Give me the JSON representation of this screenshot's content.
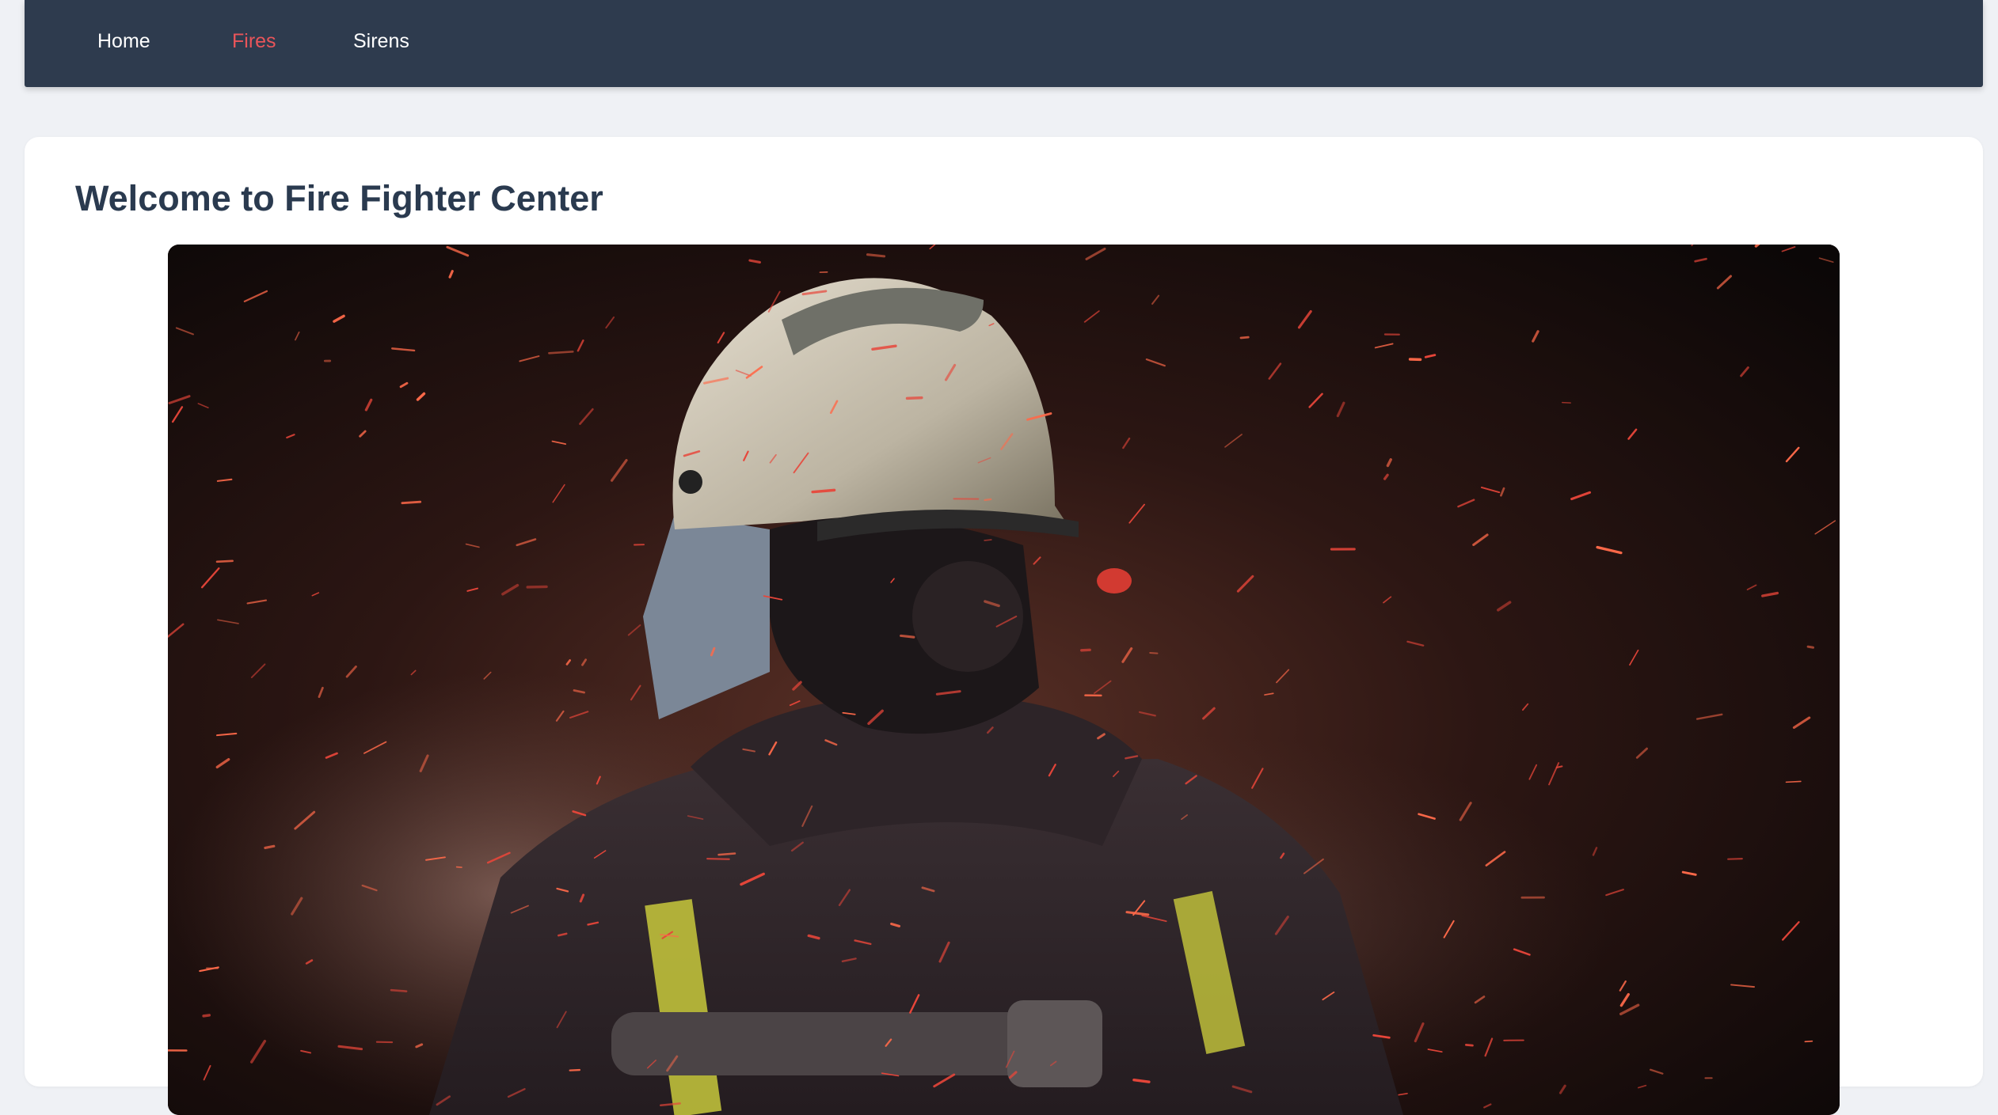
{
  "nav": {
    "items": [
      {
        "label": "Home",
        "active": false
      },
      {
        "label": "Fires",
        "active": true
      },
      {
        "label": "Sirens",
        "active": false
      }
    ]
  },
  "main": {
    "title": "Welcome to Fire Fighter Center",
    "hero_image": "firefighter-in-helmet-among-sparks"
  },
  "colors": {
    "nav_bg": "#2e3b4e",
    "active_link": "#e9555a",
    "page_bg": "#eff1f5",
    "title": "#2a3a4f"
  }
}
